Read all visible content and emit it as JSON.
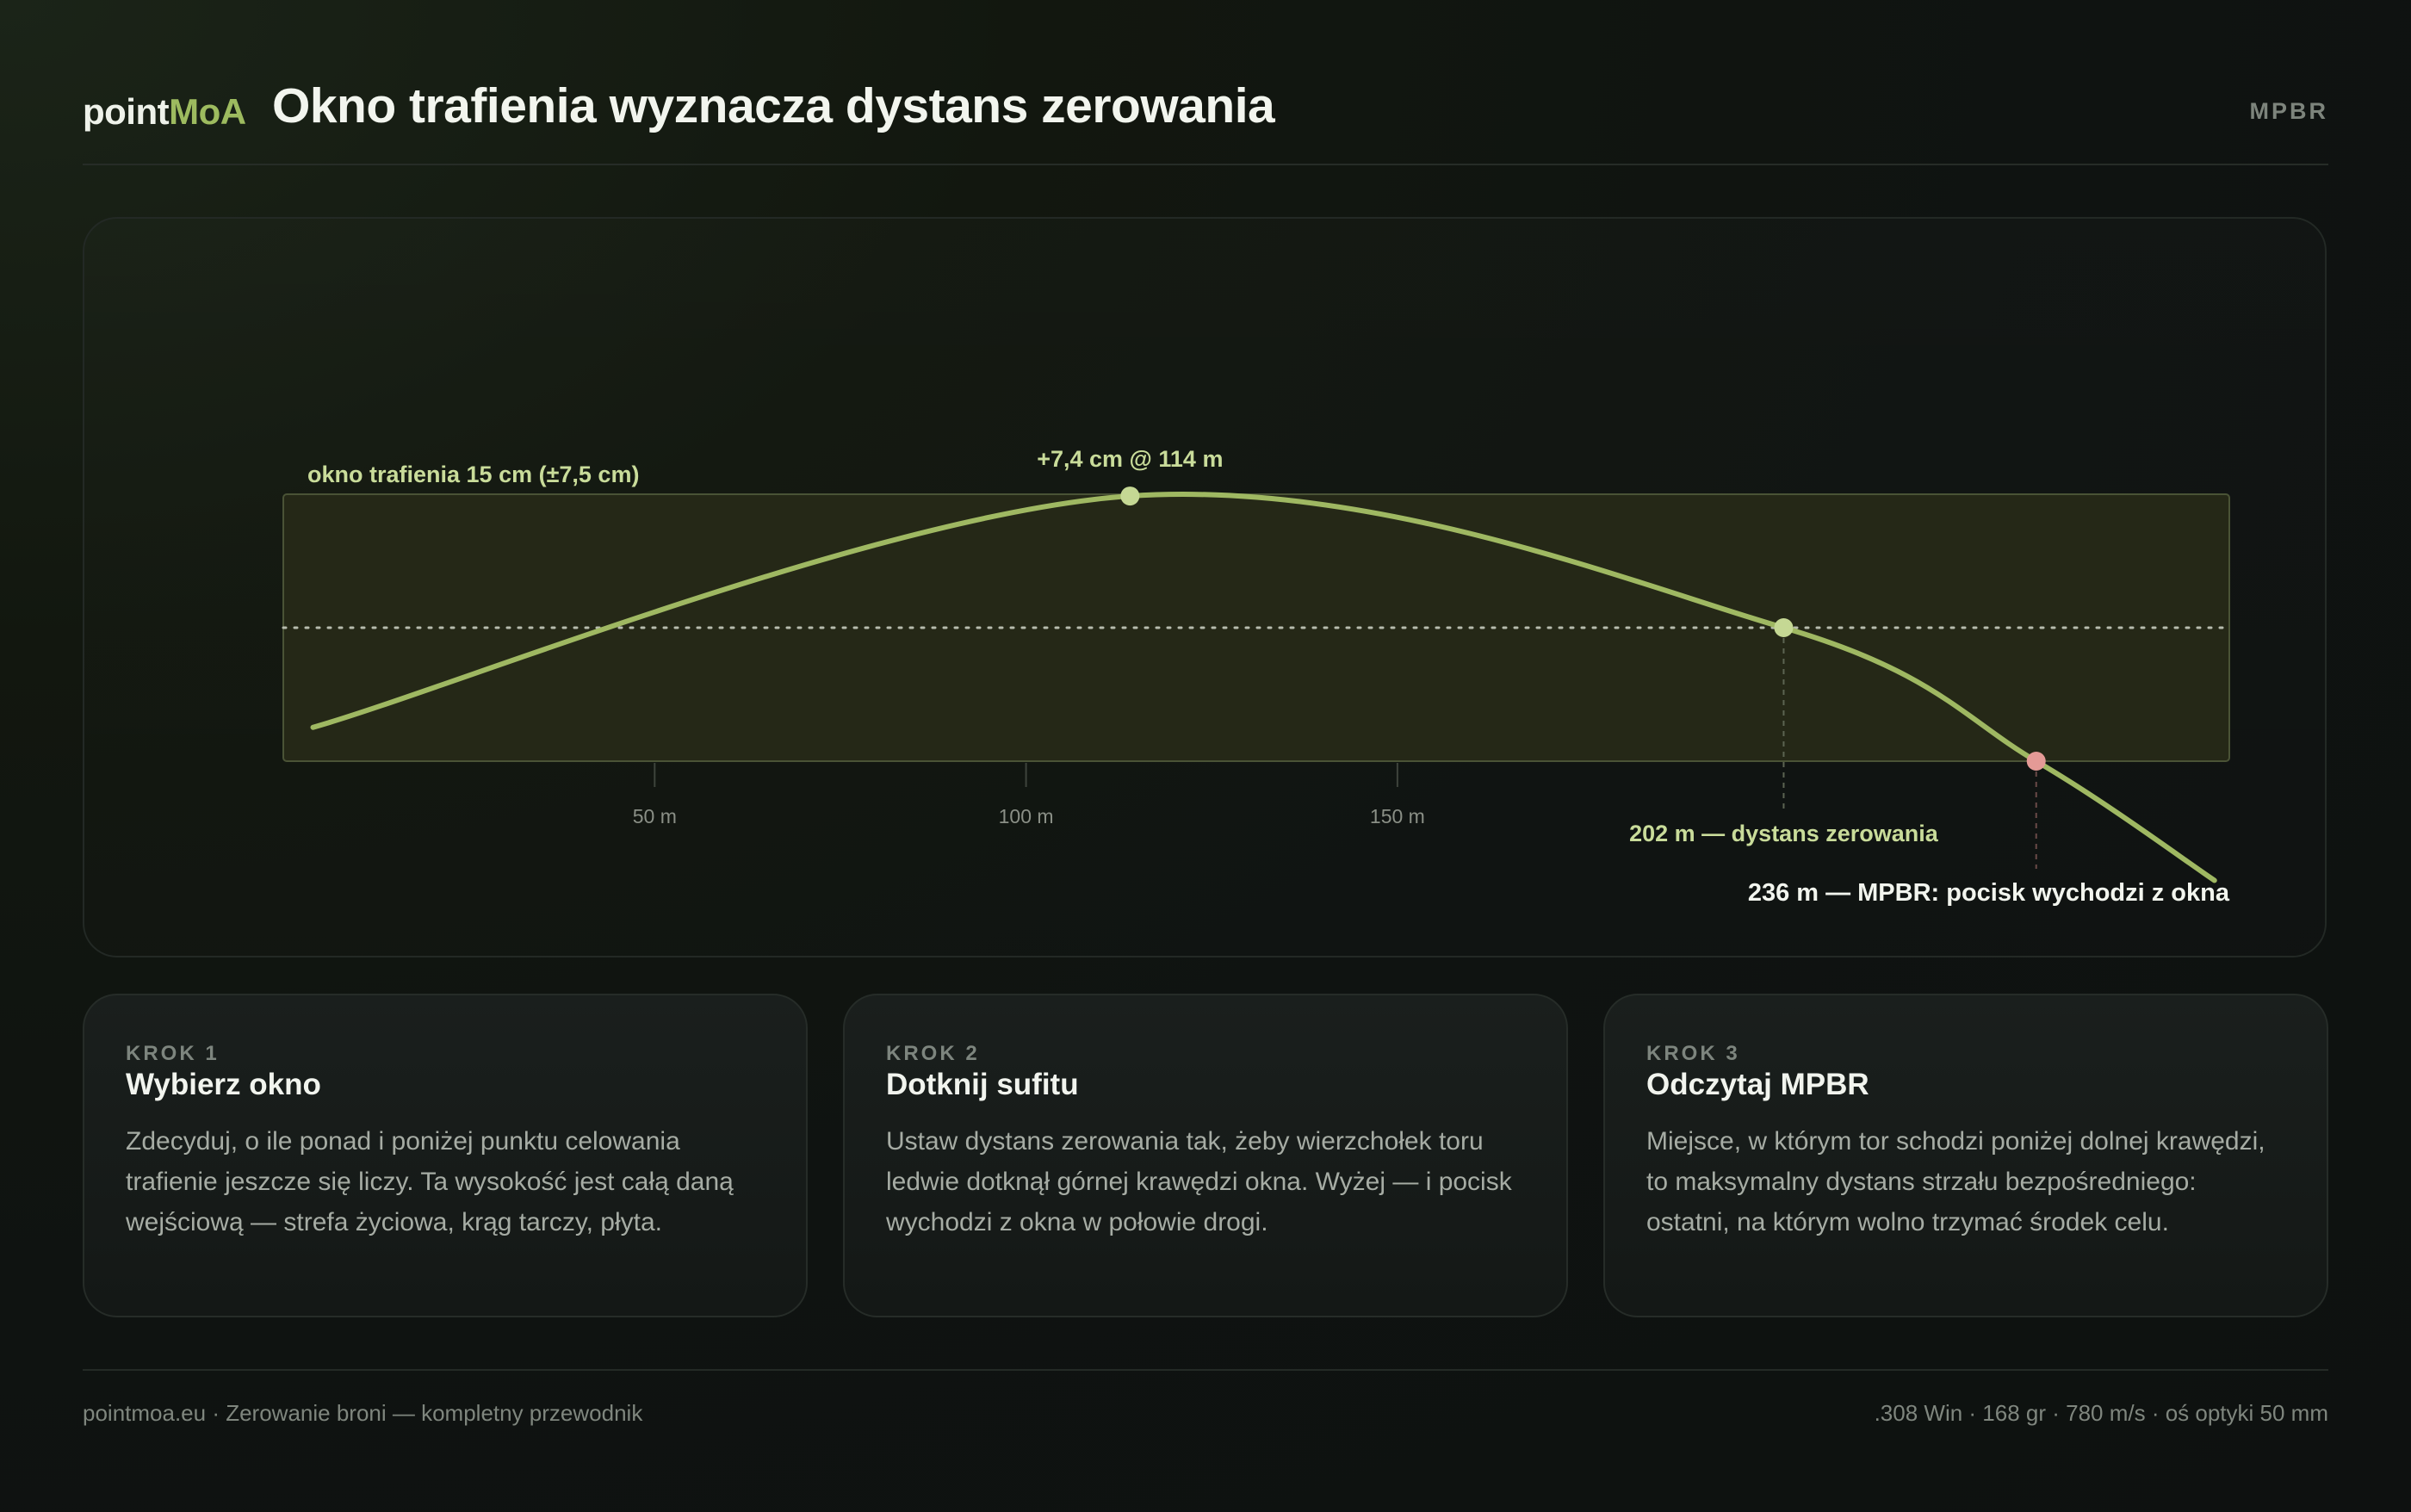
{
  "header": {
    "brand_part1": "point",
    "brand_part2": "MoA",
    "title": "Okno trafienia wyznacza dystans zerowania",
    "tag": "MPBR"
  },
  "diagram": {
    "window_label": "okno trafienia 15 cm (±7,5 cm)",
    "apex_label": "+7,4 cm @ 114 m",
    "zero_label": "202 m — dystans zerowania",
    "mpbr_label": "236 m — MPBR: pocisk wychodzi z okna",
    "x_axis_ticks": [
      {
        "value": 50,
        "label": "50 m"
      },
      {
        "value": 100,
        "label": "100 m"
      },
      {
        "value": 150,
        "label": "150 m"
      }
    ],
    "window_half_height_cm": 7.5,
    "range_max_m": 262,
    "trajectory": {
      "start": {
        "distance_m": 4,
        "height_cm": -5.6
      },
      "apex": {
        "distance_m": 114,
        "height_cm": 7.4
      },
      "zero": {
        "distance_m": 202,
        "height_cm": 0
      },
      "mpbr": {
        "distance_m": 236,
        "height_cm": -7.5
      },
      "end": {
        "distance_m": 260,
        "height_cm": -14.2
      }
    },
    "colors": {
      "window_fill": "#252817",
      "window_stroke": "#4a5336",
      "trajectory": "#9fb862",
      "point": "#c5d894",
      "mpbr_point": "#e49a96",
      "label_accent": "#c9dc9a",
      "axis": "#8a8f86"
    }
  },
  "cards": [
    {
      "step": "KROK 1",
      "title": "Wybierz okno",
      "text": "Zdecyduj, o ile ponad i poniżej punktu celowania trafienie jeszcze się liczy. Ta wysokość jest całą daną wejściową — strefa życiowa, krąg tarczy, płyta."
    },
    {
      "step": "KROK 2",
      "title": "Dotknij sufitu",
      "text": "Ustaw dystans zerowania tak, żeby wierzchołek toru ledwie dotknął górnej krawędzi okna. Wyżej — i pocisk wychodzi z okna w połowie drogi."
    },
    {
      "step": "KROK 3",
      "title": "Odczytaj MPBR",
      "text": "Miejsce, w którym tor schodzi poniżej dolnej krawędzi, to maksymalny dystans strzału bezpośredniego: ostatni, na którym wolno trzymać środek celu."
    }
  ],
  "footer": {
    "left": "pointmoa.eu · Zerowanie broni — kompletny przewodnik",
    "right": ".308 Win · 168 gr · 780 m/s · oś optyki 50 mm"
  }
}
